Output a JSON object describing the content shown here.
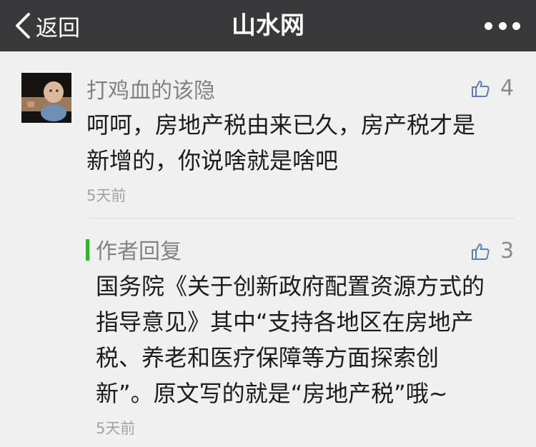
{
  "nav": {
    "back_label": "返回",
    "title": "山水网",
    "more_icon": "more-dots-icon"
  },
  "comment": {
    "username": "打鸡血的该隐",
    "likes": "4",
    "text_lines": [
      "呵呵，房地产税由来已久，房产税才是",
      "新增的，你说啥就是啥吧"
    ],
    "time": "5天前",
    "like_icon": "thumbs-up-icon"
  },
  "reply": {
    "label": "作者回复",
    "likes": "3",
    "text_lines": [
      "国务院《关于创新政府配置资源方式的",
      "指导意见》其中“支持各地区在房地产",
      "税、养老和医疗保障等方面探索创",
      "新”。原文写的就是“房地产税”哦~"
    ],
    "time": "5天前",
    "accent": "#2fb52c",
    "like_icon": "thumbs-up-icon"
  }
}
